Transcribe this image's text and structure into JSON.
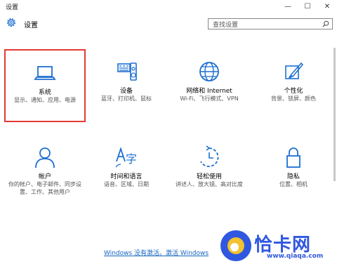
{
  "window": {
    "title": "设置",
    "minimize_icon": "minimize-icon",
    "maximize_icon": "maximize-icon",
    "close_icon": "close-icon"
  },
  "header": {
    "title": "设置",
    "icon": "gear-icon",
    "search_placeholder": "查找设置"
  },
  "tiles": [
    {
      "name": "系统",
      "desc": "显示、通知、应用、电源",
      "icon": "laptop-icon",
      "selected": true
    },
    {
      "name": "设备",
      "desc": "蓝牙、打印机、鼠标",
      "icon": "devices-icon"
    },
    {
      "name": "网络和 Internet",
      "desc": "Wi-Fi、飞行模式、VPN",
      "icon": "globe-icon"
    },
    {
      "name": "个性化",
      "desc": "背景、锁屏、颜色",
      "icon": "paintbrush-icon"
    },
    {
      "name": "帐户",
      "desc": "你的帐户、电子邮件、同步设置、工作、其他用户",
      "icon": "person-icon"
    },
    {
      "name": "时间和语言",
      "desc": "语音、区域、日期",
      "icon": "time-language-icon"
    },
    {
      "name": "轻松使用",
      "desc": "讲述人、放大镜、高对比度",
      "icon": "ease-of-access-icon"
    },
    {
      "name": "隐私",
      "desc": "位置、相机",
      "icon": "lock-icon"
    }
  ],
  "footer": {
    "activate_link": "Windows 没有激活。激活 Windows"
  },
  "watermark": {
    "text": "恰卡网",
    "url": "www.qiaqa.com"
  },
  "colors": {
    "accent": "#1e6fd1",
    "selection": "#e53935",
    "link": "#1565c0",
    "watermark": "#2f57e0"
  }
}
